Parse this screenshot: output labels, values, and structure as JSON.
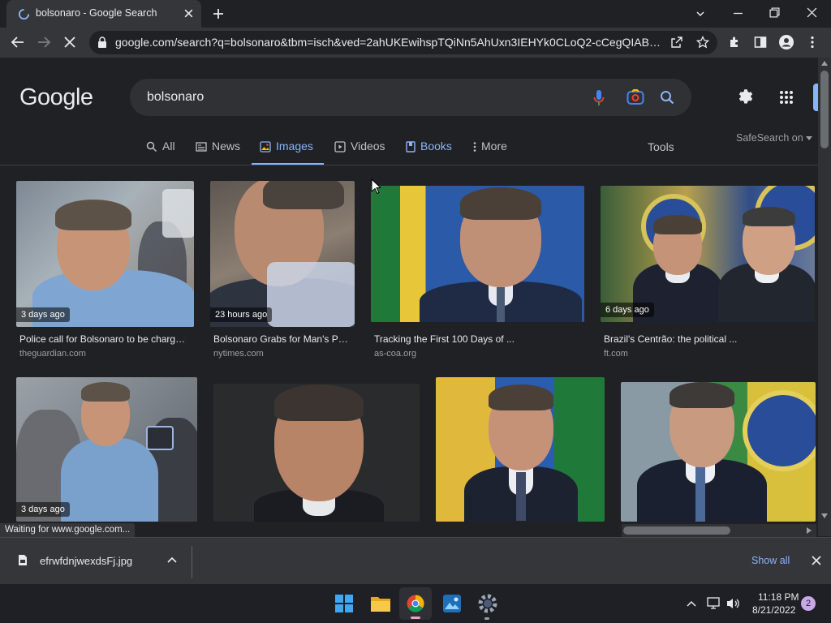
{
  "browser": {
    "tab_title": "bolsonaro - Google Search",
    "url": "google.com/search?q=bolsonaro&tbm=isch&ved=2ahUKEwihspTQiNn5AhUxn3IEHYk0CLoQ2-cCegQIABA..."
  },
  "page": {
    "logo": "Google",
    "query": "bolsonaro",
    "tabs": [
      {
        "label": "All",
        "icon": "search-icon"
      },
      {
        "label": "News",
        "icon": "news-icon"
      },
      {
        "label": "Images",
        "icon": "image-icon",
        "active": true
      },
      {
        "label": "Videos",
        "icon": "play-icon"
      },
      {
        "label": "Books",
        "icon": "book-icon"
      },
      {
        "label": "More",
        "icon": "more-vert-icon"
      }
    ],
    "tools": "Tools",
    "safesearch": "SafeSearch on"
  },
  "results": [
    {
      "badge": "3 days ago",
      "title": "Police call for Bolsonaro to be charged over ...",
      "source": "theguardian.com"
    },
    {
      "badge": "23 hours ago",
      "title": "Bolsonaro Grabs for Man's Phone ...",
      "source": "nytimes.com"
    },
    {
      "badge": "",
      "title": "Tracking the First 100 Days of ...",
      "source": "as-coa.org"
    },
    {
      "badge": "6 days ago",
      "title": "Brazil's Centrão: the political ...",
      "source": "ft.com"
    },
    {
      "badge": "3 days ago",
      "title": "",
      "source": ""
    },
    {
      "badge": "",
      "title": "",
      "source": ""
    },
    {
      "badge": "",
      "title": "",
      "source": ""
    },
    {
      "badge": "",
      "title": "",
      "source": ""
    }
  ],
  "status_text": "Waiting for www.google.com...",
  "download": {
    "filename": "efrwfdnjwexdsFj.jpg",
    "show_all": "Show all"
  },
  "taskbar": {
    "time": "11:18 PM",
    "date": "8/21/2022",
    "notifications": "2"
  },
  "colors": {
    "accent": "#8ab4f8",
    "page_bg": "#202124",
    "chrome_bg": "#35363a"
  }
}
